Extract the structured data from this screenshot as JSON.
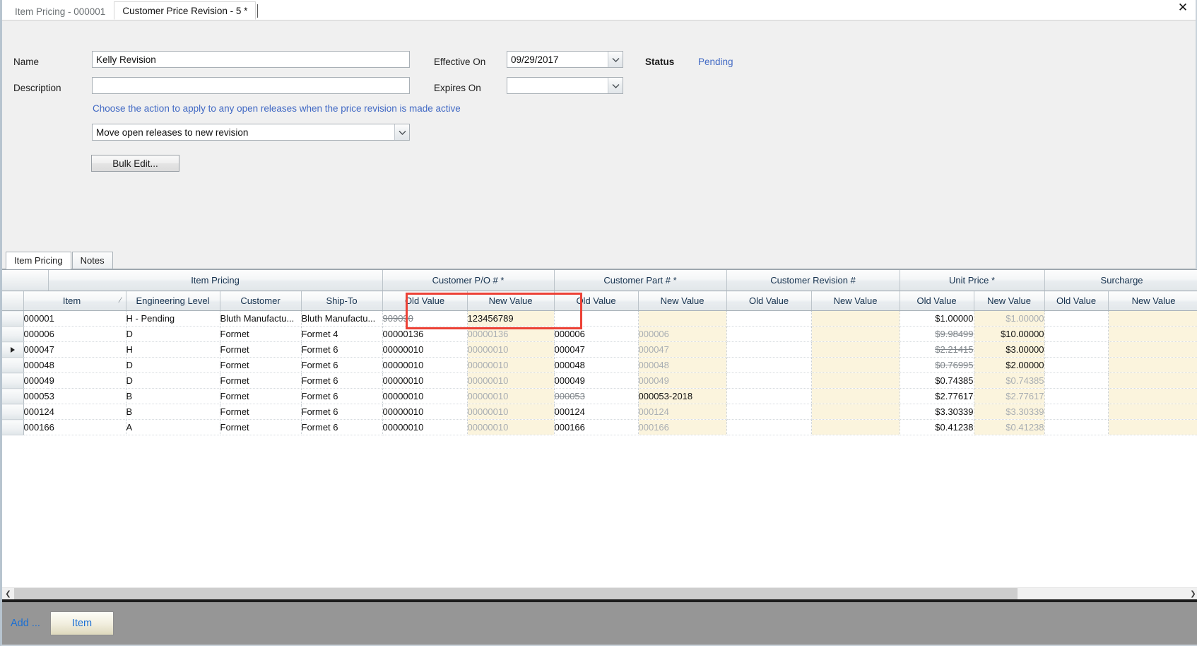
{
  "window": {
    "close_label": "✕"
  },
  "doc_tabs": [
    {
      "label": "Item Pricing - 000001",
      "active": false
    },
    {
      "label": "Customer Price Revision - 5 *",
      "active": true
    }
  ],
  "form": {
    "name_label": "Name",
    "name_value": "Kelly Revision",
    "description_label": "Description",
    "description_value": "",
    "description_placeholder": "",
    "effective_on_label": "Effective On",
    "effective_on_value": "09/29/2017",
    "expires_on_label": "Expires On",
    "expires_on_value": "",
    "status_label": "Status",
    "status_value": "Pending",
    "hint_text": "Choose the action to apply to any open releases when the price revision is made active",
    "action_value": "Move open releases to new revision",
    "bulk_edit_label": "Bulk Edit..."
  },
  "lower_tabs": [
    {
      "label": "Item Pricing",
      "selected": true
    },
    {
      "label": "Notes",
      "selected": false
    }
  ],
  "grid": {
    "group_headers": [
      {
        "label": "Item Pricing",
        "span": 4
      },
      {
        "label": "Customer P/O # *",
        "span": 2
      },
      {
        "label": "Customer Part # *",
        "span": 2
      },
      {
        "label": "Customer Revision #",
        "span": 2
      },
      {
        "label": "Unit Price *",
        "span": 2
      },
      {
        "label": "Surcharge",
        "span": 2
      }
    ],
    "sub_headers": [
      "Item",
      "Engineering Level",
      "Customer",
      "Ship-To",
      "Old Value",
      "New Value",
      "Old Value",
      "New Value",
      "Old Value",
      "New Value",
      "Old Value",
      "New Value",
      "Old Value",
      "New Value"
    ],
    "sort_mark": "⁄",
    "rows": [
      {
        "current": false,
        "item": "000001",
        "engineering_level": "H - Pending",
        "customer": "Bluth  Manufactu...",
        "ship_to": "Bluth  Manufactu...",
        "po_old": "909090",
        "po_old_struck": true,
        "po_new": "123456789",
        "po_new_ghost": false,
        "part_old": "",
        "part_old_struck": false,
        "part_new": "",
        "part_new_ghost": true,
        "rev_old": "",
        "rev_new": "",
        "price_old": "$1.00000",
        "price_old_struck": false,
        "price_new": "$1.00000",
        "price_new_ghost": true,
        "sur_old": "",
        "sur_new": ""
      },
      {
        "current": false,
        "item": "000006",
        "engineering_level": "D",
        "customer": "Formet",
        "ship_to": "Formet 4",
        "po_old": "00000136",
        "po_old_struck": false,
        "po_new": "00000136",
        "po_new_ghost": true,
        "part_old": "000006",
        "part_old_struck": false,
        "part_new": "000006",
        "part_new_ghost": true,
        "rev_old": "",
        "rev_new": "",
        "price_old": "$9.98499",
        "price_old_struck": true,
        "price_new": "$10.00000",
        "price_new_ghost": false,
        "sur_old": "",
        "sur_new": ""
      },
      {
        "current": true,
        "item": "000047",
        "engineering_level": "H",
        "customer": "Formet",
        "ship_to": "Formet 6",
        "po_old": "00000010",
        "po_old_struck": false,
        "po_new": "00000010",
        "po_new_ghost": true,
        "part_old": "000047",
        "part_old_struck": false,
        "part_new": "000047",
        "part_new_ghost": true,
        "rev_old": "",
        "rev_new": "",
        "price_old": "$2.21415",
        "price_old_struck": true,
        "price_new": "$3.00000",
        "price_new_ghost": false,
        "sur_old": "",
        "sur_new": ""
      },
      {
        "current": false,
        "item": "000048",
        "engineering_level": "D",
        "customer": "Formet",
        "ship_to": "Formet 6",
        "po_old": "00000010",
        "po_old_struck": false,
        "po_new": "00000010",
        "po_new_ghost": true,
        "part_old": "000048",
        "part_old_struck": false,
        "part_new": "000048",
        "part_new_ghost": true,
        "rev_old": "",
        "rev_new": "",
        "price_old": "$0.76995",
        "price_old_struck": true,
        "price_new": "$2.00000",
        "price_new_ghost": false,
        "sur_old": "",
        "sur_new": ""
      },
      {
        "current": false,
        "item": "000049",
        "engineering_level": "D",
        "customer": "Formet",
        "ship_to": "Formet 6",
        "po_old": "00000010",
        "po_old_struck": false,
        "po_new": "00000010",
        "po_new_ghost": true,
        "part_old": "000049",
        "part_old_struck": false,
        "part_new": "000049",
        "part_new_ghost": true,
        "rev_old": "",
        "rev_new": "",
        "price_old": "$0.74385",
        "price_old_struck": false,
        "price_new": "$0.74385",
        "price_new_ghost": true,
        "sur_old": "",
        "sur_new": ""
      },
      {
        "current": false,
        "item": "000053",
        "engineering_level": "B",
        "customer": "Formet",
        "ship_to": "Formet 6",
        "po_old": "00000010",
        "po_old_struck": false,
        "po_new": "00000010",
        "po_new_ghost": true,
        "part_old": "000053",
        "part_old_struck": true,
        "part_new": "000053-2018",
        "part_new_ghost": false,
        "rev_old": "",
        "rev_new": "",
        "price_old": "$2.77617",
        "price_old_struck": false,
        "price_new": "$2.77617",
        "price_new_ghost": true,
        "sur_old": "",
        "sur_new": ""
      },
      {
        "current": false,
        "item": "000124",
        "engineering_level": "B",
        "customer": "Formet",
        "ship_to": "Formet 6",
        "po_old": "00000010",
        "po_old_struck": false,
        "po_new": "00000010",
        "po_new_ghost": true,
        "part_old": "000124",
        "part_old_struck": false,
        "part_new": "000124",
        "part_new_ghost": true,
        "rev_old": "",
        "rev_new": "",
        "price_old": "$3.30339",
        "price_old_struck": false,
        "price_new": "$3.30339",
        "price_new_ghost": true,
        "sur_old": "",
        "sur_new": ""
      },
      {
        "current": false,
        "item": "000166",
        "engineering_level": "A",
        "customer": "Formet",
        "ship_to": "Formet 6",
        "po_old": "00000010",
        "po_old_struck": false,
        "po_new": "00000010",
        "po_new_ghost": true,
        "part_old": "000166",
        "part_old_struck": false,
        "part_new": "000166",
        "part_new_ghost": true,
        "rev_old": "",
        "rev_new": "",
        "price_old": "$0.41238",
        "price_old_struck": false,
        "price_new": "$0.41238",
        "price_new_ghost": true,
        "sur_old": "",
        "sur_new": ""
      }
    ]
  },
  "scrollbar": {
    "left_arrow": "❮",
    "right_arrow": "❯"
  },
  "bottom_bar": {
    "add_label": "Add ...",
    "item_button_label": "Item"
  },
  "colors": {
    "link": "#4169c4",
    "annotation": "#ec4136",
    "shade": "#fbf4dd",
    "bottom_bar": "#969696"
  }
}
